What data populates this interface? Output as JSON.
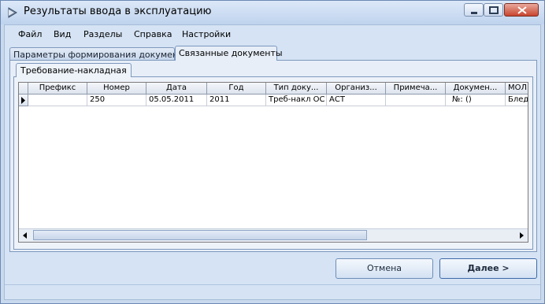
{
  "window": {
    "title": "Результаты ввода в эксплуатацию",
    "icon": "arrow-app-icon",
    "buttons": [
      "minimize-icon",
      "maximize-icon",
      "close-icon"
    ]
  },
  "menu": {
    "items": [
      "Файл",
      "Вид",
      "Разделы",
      "Справка",
      "Настройки"
    ]
  },
  "tabs": {
    "items": [
      "Параметры формирования документов",
      "Связанные документы"
    ],
    "active_index": 1
  },
  "subtab": {
    "label": "Требование-накладная"
  },
  "grid": {
    "columns": [
      "Префикс",
      "Номер",
      "Дата",
      "Год",
      "Тип доку...",
      "Организ...",
      "Примеча...",
      "Докумен...",
      "МОЛ"
    ],
    "rows": [
      [
        "",
        "250",
        "05.05.2011",
        "2011",
        "Треб-накл ОС",
        "АСТ",
        "",
        "№: ()",
        "Блед"
      ]
    ]
  },
  "buttons": {
    "cancel": "Отмена",
    "next": "Далее >"
  },
  "colors": {
    "frame": "#c9d9ee",
    "panel": "#e7eef8",
    "accent": "#3e6aa8"
  }
}
